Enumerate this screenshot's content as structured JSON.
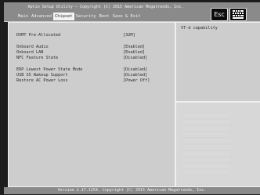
{
  "header": {
    "title": "Aptio Setup Utility – Copyright (C) 2015 American Megatrends, Inc.",
    "tabs": [
      "Main",
      "Advanced",
      "Chipset",
      "Security",
      "Boot",
      "Save & Exit"
    ],
    "active_tab": "Chipset",
    "esc_label": "Esc"
  },
  "settings": {
    "rows": [
      {
        "label": "DVMT Pre-Allocated",
        "value": "[32M]"
      },
      {
        "label": "Onboard Audio",
        "value": "[Enabled]"
      },
      {
        "label": "Onboard LAN",
        "value": "[Enabled]"
      },
      {
        "label": "NFC Feature State",
        "value": "[Disabled]"
      },
      {
        "label": "ERP Lowest Power State Mode",
        "value": "[Disabled]"
      },
      {
        "label": "USB S5 Wakeup Support",
        "value": "[Disabled]"
      },
      {
        "label": "Restore AC Power Loss",
        "value": "[Power Off]"
      }
    ]
  },
  "help": {
    "text": "VT-d capability"
  },
  "footer": {
    "text": "Version 2.17.1254. Copyright (C) 2015 American Megatrends, Inc."
  }
}
